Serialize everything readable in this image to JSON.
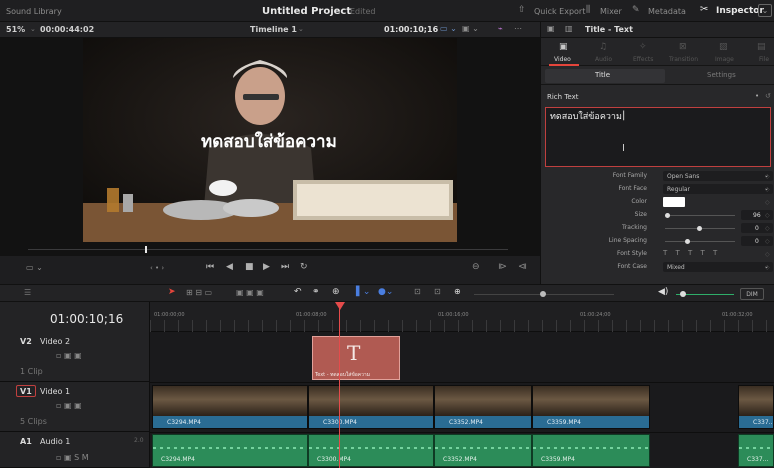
{
  "topbar": {
    "sound_library": "Sound Library",
    "project_title": "Untitled Project",
    "project_status": "Edited",
    "quick_export": "Quick Export",
    "mixer": "Mixer",
    "metadata": "Metadata",
    "inspector": "Inspector"
  },
  "viewer": {
    "zoom": "51%",
    "timecode_small": "00:00:44:02",
    "timeline_name": "Timeline 1",
    "current_tc": "01:00:10;16",
    "overlay_text": "ทดสอบใส่ข้อความ"
  },
  "inspector": {
    "panel_title": "Title - Text",
    "tabs": [
      "Video",
      "Audio",
      "Effects",
      "Transition",
      "Image",
      "File"
    ],
    "subtabs": [
      "Title",
      "Settings"
    ],
    "rich_text_label": "Rich Text",
    "rich_text_value": "ทดสอบใส่ข้อความ",
    "props": [
      {
        "label": "Font Family",
        "value": "Open Sans"
      },
      {
        "label": "Font Face",
        "value": "Regular"
      },
      {
        "label": "Color",
        "value": ""
      },
      {
        "label": "Size",
        "value": "96"
      },
      {
        "label": "Tracking",
        "value": "0"
      },
      {
        "label": "Line Spacing",
        "value": "0"
      },
      {
        "label": "Font Style",
        "value": "T  T  T  T  T"
      },
      {
        "label": "Font Case",
        "value": "Mixed"
      }
    ]
  },
  "timeline": {
    "timecode": "01:00:10;16",
    "ruler": [
      "01:00:00;00",
      "01:00:08;00",
      "01:00:16;00",
      "01:00:24;00",
      "01:00:32;00"
    ],
    "dim_label": "DIM",
    "tracks": [
      {
        "id": "V2",
        "name": "Video 2",
        "clips": "1 Clip"
      },
      {
        "id": "V1",
        "name": "Video 1",
        "clips": "5 Clips"
      },
      {
        "id": "A1",
        "name": "Audio 1",
        "level": "2.0"
      }
    ],
    "title_clip": {
      "letter": "T",
      "label": "Text - ทดสอบใส่ข้อความ"
    },
    "video_clips": [
      "C3294.MP4",
      "C3300.MP4",
      "C3352.MP4",
      "C3359.MP4",
      "C337..."
    ],
    "audio_clips": [
      "C3294.MP4",
      "C3300.MP4",
      "C3352.MP4",
      "C3359.MP4",
      "C337..."
    ]
  },
  "colors": {
    "playhead": "#e54b4b",
    "accent": "#c0403f",
    "video_clip": "#2a6c93",
    "audio_clip": "#2c8c59"
  }
}
